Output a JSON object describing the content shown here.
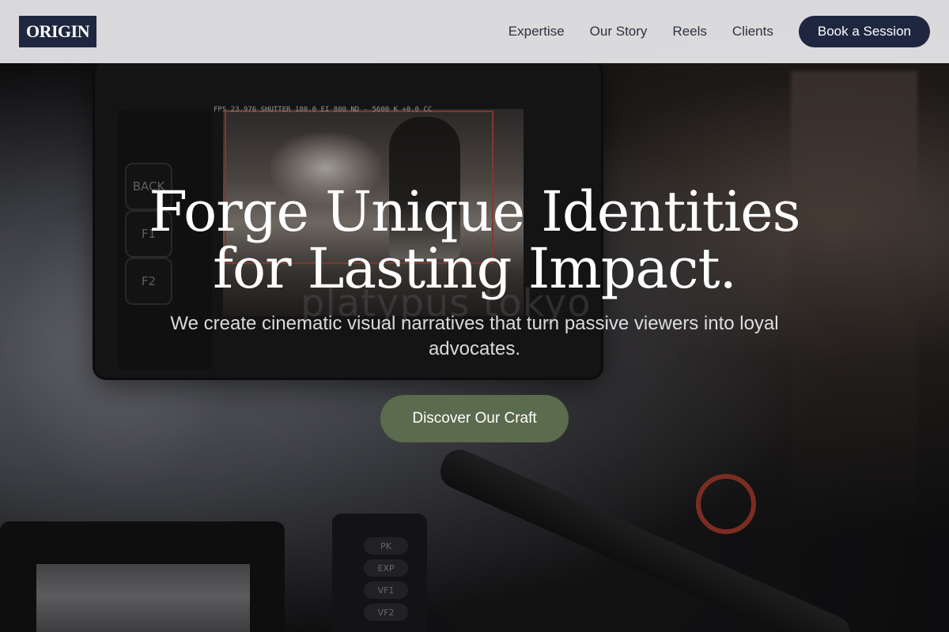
{
  "header": {
    "logo_text": "ORIGIN",
    "nav": [
      {
        "label": "Expertise"
      },
      {
        "label": "Our Story"
      },
      {
        "label": "Reels"
      },
      {
        "label": "Clients"
      }
    ],
    "cta_label": "Book a Session"
  },
  "hero": {
    "title_line1": "Forge Unique Identities",
    "title_line2": "for Lasting Impact.",
    "subtitle": "We create cinematic visual narratives that turn passive viewers into loyal advocates.",
    "cta_label": "Discover Our Craft",
    "background_watermark": "platypus tokyo",
    "monitor_osd": "FPS 23.976   SHUTTER 180.0        EI 800   ND -   5600 K   +0.0 CC",
    "monitor_keys": [
      "BACK",
      "F1",
      "F2"
    ],
    "cluster_keys": [
      "PK",
      "EXP",
      "VF1",
      "VF2"
    ]
  },
  "colors": {
    "brand_navy": "#1f2740",
    "cta_green": "#5b6b4e",
    "header_bg": "#ebecee"
  }
}
